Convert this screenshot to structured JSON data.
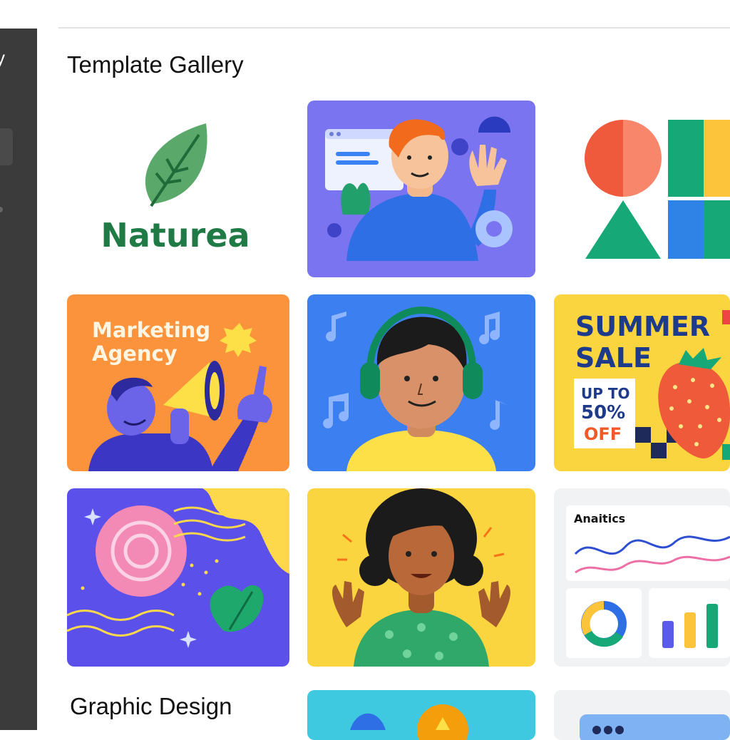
{
  "sidebar": {
    "partial_label": "y"
  },
  "gallery": {
    "title": "Template Gallery"
  },
  "templates": {
    "naturea": {
      "brand": "Naturea"
    },
    "marketing": {
      "line1": "Marketing",
      "line2": "Agency"
    },
    "summer": {
      "line1": "SUMMER",
      "line2": "SALE",
      "offer1": "UP TO",
      "offer2": "50%",
      "offer3": "OFF"
    },
    "analytics": {
      "label": "Anaitics"
    }
  },
  "section": {
    "title": "Graphic Design"
  },
  "colors": {
    "purple": "#7b74f0",
    "orange": "#fb923c",
    "blue": "#3b7ff0",
    "yellow": "#fbd540",
    "green": "#1f7a45",
    "navy": "#1e3a8a"
  }
}
